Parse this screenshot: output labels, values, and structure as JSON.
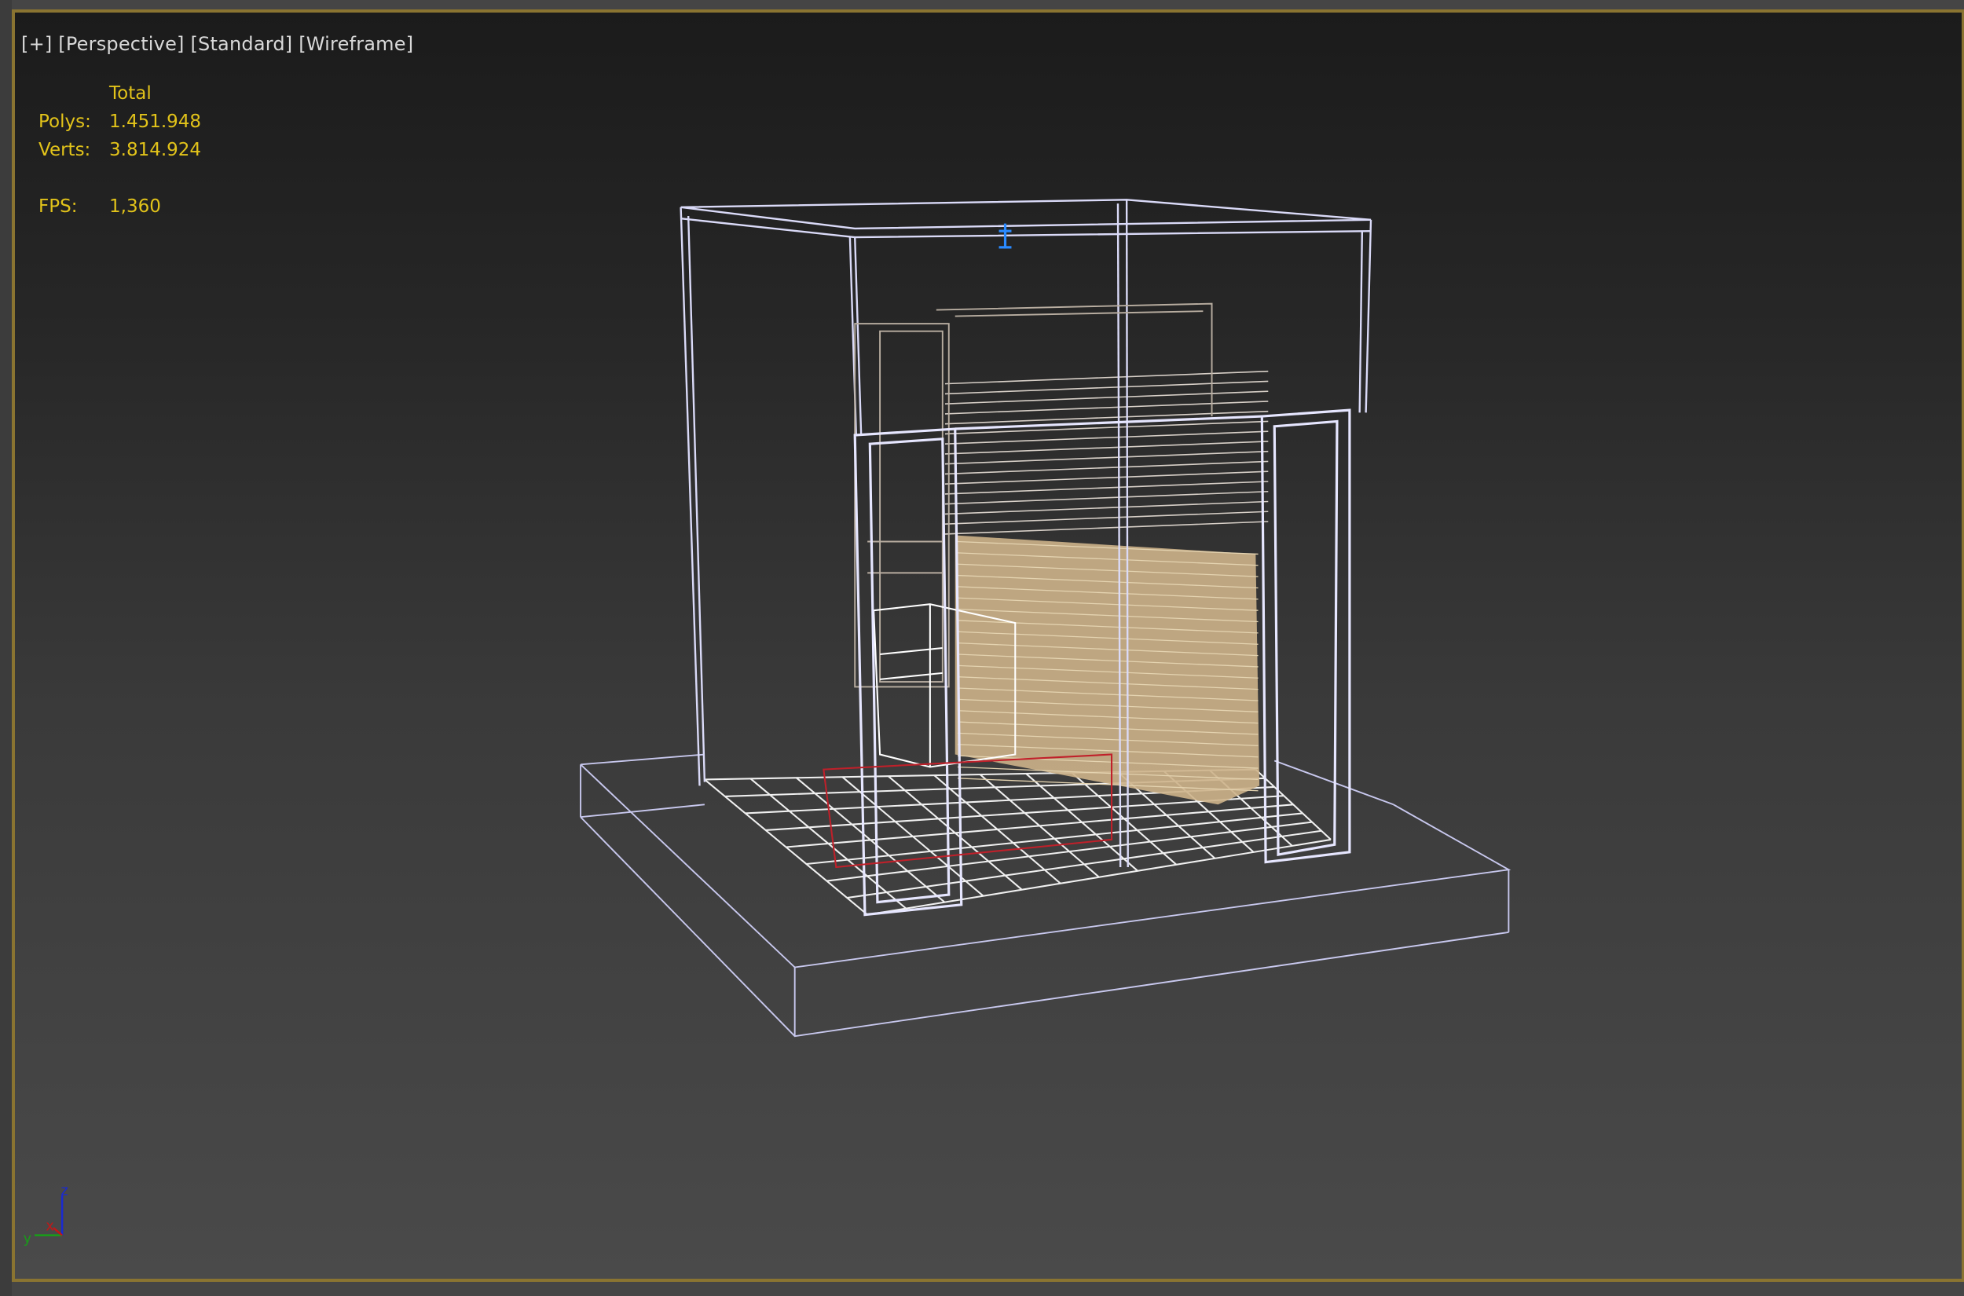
{
  "viewport": {
    "menu_plus": "[+]",
    "view_label": "[Perspective]",
    "shading_standard": "[Standard]",
    "shading_mode": "[Wireframe]"
  },
  "stats": {
    "header": "Total",
    "polys_label": "Polys:",
    "polys_value": "1.451.948",
    "verts_label": "Verts:",
    "verts_value": "3.814.924",
    "fps_label": "FPS:",
    "fps_value": "1,360"
  },
  "axis": {
    "x": "x",
    "y": "y",
    "z": "z"
  },
  "colors": {
    "border": "#8a7431",
    "stats": "#e2c31a",
    "wire": "#c8c8f0",
    "fill": "#cdb38a",
    "selection": "#c0202a"
  }
}
